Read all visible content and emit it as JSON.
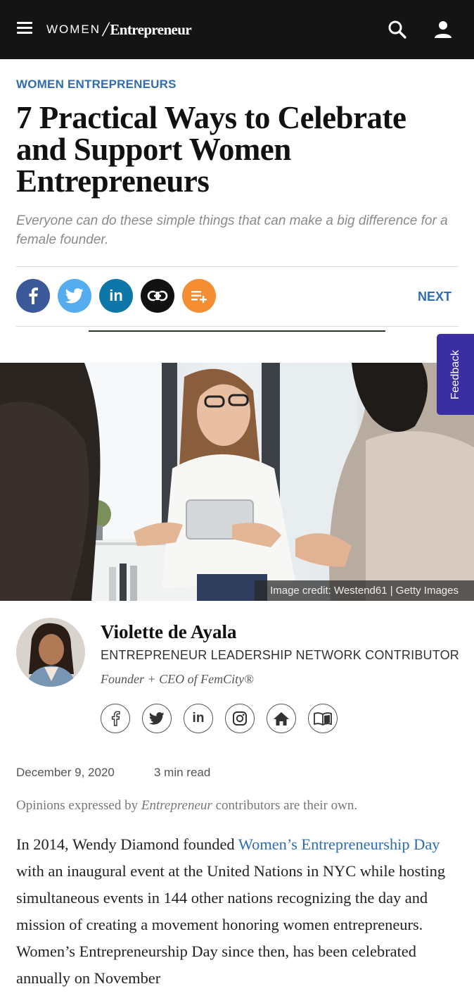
{
  "header": {
    "logo_women": "WOMEN",
    "logo_slash": "/",
    "logo_brand": "Entrepreneur",
    "icons": [
      "menu-icon",
      "search-icon",
      "user-icon"
    ],
    "background": "#141414"
  },
  "article": {
    "kicker": "WOMEN ENTREPRENEURS",
    "headline": "7 Practical Ways to Celebrate and Support Women Entrepreneurs",
    "dek": "Everyone can do these simple things that can make a big difference for a female founder.",
    "next_label": "NEXT",
    "share_buttons": [
      {
        "icon": "facebook-icon",
        "glyph": "f",
        "color": "#3b5998"
      },
      {
        "icon": "twitter-icon",
        "glyph": "",
        "color": "#55acee"
      },
      {
        "icon": "linkedin-icon",
        "glyph": "in",
        "color": "#0e76a8"
      },
      {
        "icon": "link-icon",
        "glyph": "",
        "color": "#111111"
      },
      {
        "icon": "add-to-list-icon",
        "glyph": "",
        "color": "#f58d32"
      }
    ],
    "image_credit": "Image credit: Westend61 | Getty Images",
    "feedback_label": "Feedback"
  },
  "author": {
    "name": "Violette de Ayala",
    "role": "ENTREPRENEUR LEADERSHIP NETWORK CONTRIBUTOR",
    "title": "Founder + CEO of FemCity®",
    "social_icons": [
      "facebook-icon",
      "twitter-icon",
      "linkedin-icon",
      "instagram-icon",
      "home-icon",
      "book-icon"
    ]
  },
  "meta": {
    "date": "December 9, 2020",
    "read_time": "3 min read",
    "opinion_pre": "Opinions expressed by ",
    "opinion_brand": "Entrepreneur",
    "opinion_post": " contributors are their own."
  },
  "body": {
    "p1_pre": "In 2014, Wendy Diamond founded ",
    "p1_link": "Women’s Entrepreneurship Day",
    "p1_post": " with an inaugural event at the United Nations in NYC while hosting simultaneous events in 144 other nations recognizing the day and mission of creating a movement honoring women entrepreneurs. Women’s Entrepreneurship Day since then, has been celebrated annually on November"
  },
  "colors": {
    "accent": "#2f6db0",
    "feedback": "#3b2ea3"
  }
}
